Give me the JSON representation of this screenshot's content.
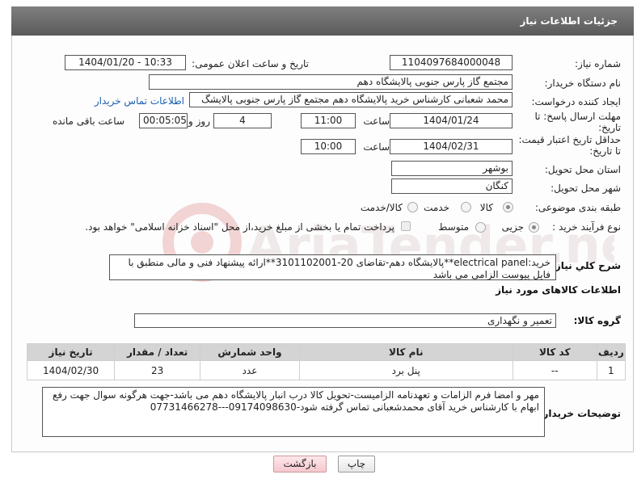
{
  "header": {
    "title": "جزئیات اطلاعات نیاز"
  },
  "labels": {
    "need_number": "شماره نیاز:",
    "announce_datetime": "تاریخ و ساعت اعلان عمومی:",
    "buyer_org": "نام دستگاه خریدار:",
    "requester": "ایجاد کننده درخواست:",
    "reply_deadline": "مهلت ارسال پاسخ: تا تاریخ:",
    "price_validity": "حداقل تاریخ اعتبار قیمت: تا تاریخ:",
    "time": "ساعت",
    "day_and": "روز و",
    "remaining": "ساعت باقی مانده",
    "province": "استان محل تحویل:",
    "city": "شهر محل تحویل:",
    "category": "طبقه بندی موضوعی:",
    "process_type": "نوع فرآیند خرید :",
    "general_desc": "شرح كلي نياز:",
    "goods_info": "اطلاعات کالاهای مورد نیاز",
    "goods_group": "گروه کالا:",
    "buyer_notes": "توضیحات خریدار:"
  },
  "fields": {
    "need_number": "1104097684000048",
    "announce_datetime": "1404/01/20 - 10:33",
    "buyer_org": "مجتمع گاز پارس جنوبی  پالایشگاه دهم",
    "requester": "محمد شعبانی کارشناس خرید پالایشگاه دهم  مجتمع گاز پارس جنوبی  پالایشگ",
    "contact_link": "اطلاعات تماس خریدار",
    "reply_date": "1404/01/24",
    "reply_time": "11:00",
    "reply_days": "4",
    "reply_remaining": "00:05:05",
    "validity_date": "1404/02/31",
    "validity_time": "10:00",
    "province": "بوشهر",
    "city": "کنگان"
  },
  "category_options": [
    {
      "label": "کالا",
      "selected": true
    },
    {
      "label": "خدمت",
      "selected": false
    },
    {
      "label": "کالا/خدمت",
      "selected": false
    }
  ],
  "process_options": [
    {
      "label": "جزیی",
      "selected": true
    },
    {
      "label": "متوسط",
      "selected": false
    }
  ],
  "process_note": "پرداخت تمام یا بخشی از مبلغ خرید،از محل \"اسناد خزانه اسلامی\" خواهد بود.",
  "general_description": "خرید:electrical panel**پالایشگاه دهم-تقاضای 20-3101102001**ارائه پیشنهاد فنی و مالی منطبق با فایل پیوست الزامی می باشد",
  "goods_group_value": "تعمیر و نگهداری",
  "table": {
    "headers": [
      "ردیف",
      "کد کالا",
      "نام کالا",
      "واحد شمارش",
      "تعداد / مقدار",
      "تاریخ نیاز"
    ],
    "rows": [
      [
        "1",
        "--",
        "پنل برد",
        "عدد",
        "23",
        "1404/02/30"
      ]
    ]
  },
  "buyer_notes": "مهر و امضا فرم الزامات و تعهدنامه الزامیست-تحویل کالا درب انبار پالایشگاه دهم می باشد-جهت هرگونه سوال جهت رفع ابهام با کارشناس خرید آقای محمدشعبانی تماس گرفته شود-09174098630---07731466278",
  "buttons": {
    "print": "چاپ",
    "back": "بازگشت"
  },
  "watermark_text": "AriaTender.neT"
}
